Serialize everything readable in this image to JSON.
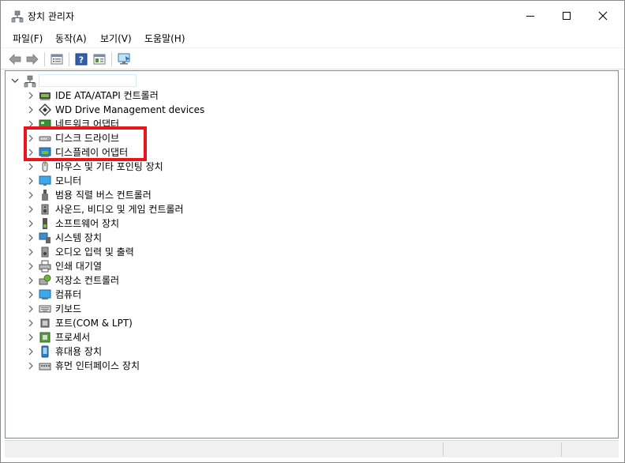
{
  "window": {
    "title": "장치 관리자"
  },
  "menu": [
    {
      "label": "파일(F)"
    },
    {
      "label": "동작(A)"
    },
    {
      "label": "보기(V)"
    },
    {
      "label": "도움말(H)"
    }
  ],
  "toolbar": {
    "icons": [
      "back-arrow-icon",
      "forward-arrow-icon",
      "properties-list-icon",
      "help-icon",
      "details-view-icon",
      "monitor-scan-icon"
    ]
  },
  "tree": {
    "root_label": "",
    "items": [
      {
        "label": "IDE ATA/ATAPI 컨트롤러",
        "icon": "ide-controller-icon"
      },
      {
        "label": "WD Drive Management devices",
        "icon": "wd-device-icon"
      },
      {
        "label": "네트워크 어댑터",
        "icon": "network-adapter-icon"
      },
      {
        "label": "디스크 드라이브",
        "icon": "disk-drive-icon"
      },
      {
        "label": "디스플레이 어댑터",
        "icon": "display-adapter-icon"
      },
      {
        "label": "마우스 및 기타 포인팅 장치",
        "icon": "mouse-icon"
      },
      {
        "label": "모니터",
        "icon": "monitor-icon"
      },
      {
        "label": "범용 직렬 버스 컨트롤러",
        "icon": "usb-icon"
      },
      {
        "label": "사운드, 비디오 및 게임 컨트롤러",
        "icon": "speaker-icon"
      },
      {
        "label": "소프트웨어 장치",
        "icon": "software-device-icon"
      },
      {
        "label": "시스템 장치",
        "icon": "system-device-icon"
      },
      {
        "label": "오디오 입력 및 출력",
        "icon": "audio-io-icon"
      },
      {
        "label": "인쇄 대기열",
        "icon": "printer-icon"
      },
      {
        "label": "저장소 컨트롤러",
        "icon": "storage-controller-icon"
      },
      {
        "label": "컴퓨터",
        "icon": "computer-icon"
      },
      {
        "label": "키보드",
        "icon": "keyboard-icon"
      },
      {
        "label": "포트(COM & LPT)",
        "icon": "port-icon"
      },
      {
        "label": "프로세서",
        "icon": "processor-icon"
      },
      {
        "label": "휴대용 장치",
        "icon": "portable-device-icon"
      },
      {
        "label": "휴먼 인터페이스 장치",
        "icon": "hid-icon"
      }
    ]
  },
  "annotation": {
    "highlight_color": "#e8161c"
  }
}
